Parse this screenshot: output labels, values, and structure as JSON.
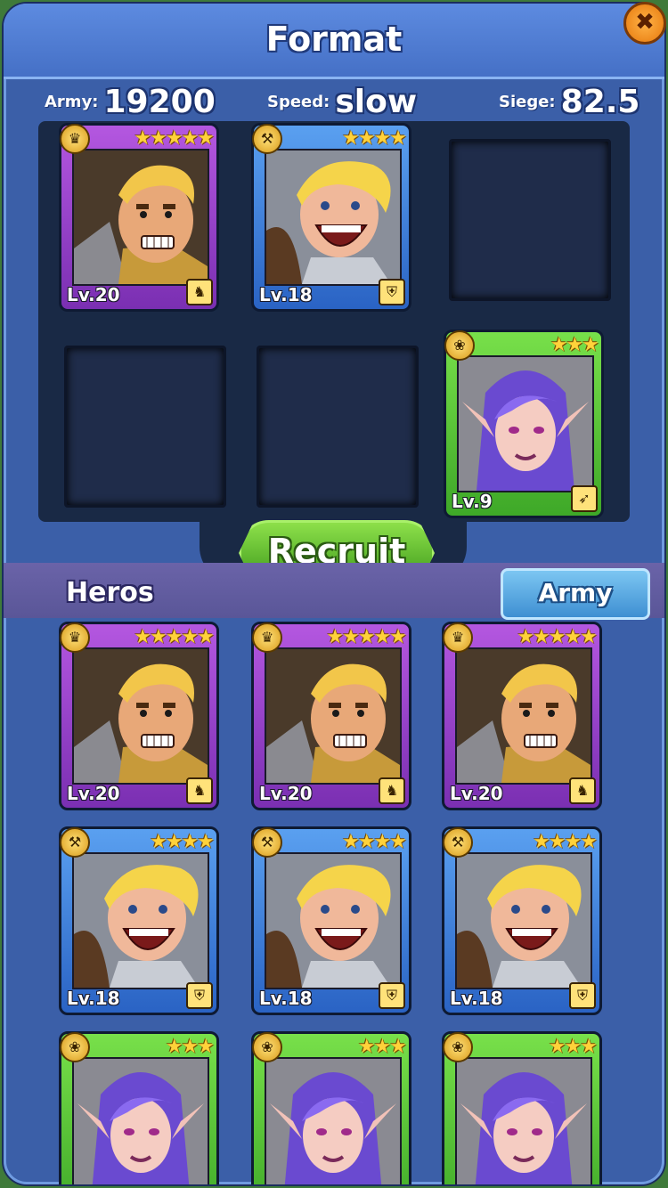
{
  "header": {
    "title": "Format",
    "close_glyph": "✖"
  },
  "stats": {
    "army_label": "Army:",
    "army_value": "19200",
    "speed_label": "Speed:",
    "speed_value": "slow",
    "siege_label": "Siege:",
    "siege_value": "82.5"
  },
  "format_slots": [
    {
      "hero": "warrior",
      "rarity": "purple",
      "stars": "★★★★★",
      "level": "Lv.20",
      "class_icon": "horse-icon"
    },
    {
      "hero": "brawler",
      "rarity": "blue",
      "stars": "★★★★",
      "level": "Lv.18",
      "class_icon": "shield-icon"
    },
    {
      "hero": null
    },
    {
      "hero": null
    },
    {
      "hero": null
    },
    {
      "hero": "elf",
      "rarity": "green",
      "stars": "★★★",
      "level": "Lv.9",
      "class_icon": "bow-icon"
    }
  ],
  "recruit_label": "Recruit",
  "heros_label": "Heros",
  "army_tab_label": "Army",
  "hero_list": [
    {
      "hero": "warrior",
      "rarity": "purple",
      "stars": "★★★★★",
      "level": "Lv.20"
    },
    {
      "hero": "warrior",
      "rarity": "purple",
      "stars": "★★★★★",
      "level": "Lv.20"
    },
    {
      "hero": "warrior",
      "rarity": "purple",
      "stars": "★★★★★",
      "level": "Lv.20"
    },
    {
      "hero": "brawler",
      "rarity": "blue",
      "stars": "★★★★",
      "level": "Lv.18"
    },
    {
      "hero": "brawler",
      "rarity": "blue",
      "stars": "★★★★",
      "level": "Lv.18"
    },
    {
      "hero": "brawler",
      "rarity": "blue",
      "stars": "★★★★",
      "level": "Lv.18"
    },
    {
      "hero": "elf",
      "rarity": "green",
      "stars": "★★★",
      "level": ""
    },
    {
      "hero": "elf",
      "rarity": "green",
      "stars": "★★★",
      "level": ""
    },
    {
      "hero": "elf",
      "rarity": "green",
      "stars": "★★★",
      "level": ""
    }
  ]
}
